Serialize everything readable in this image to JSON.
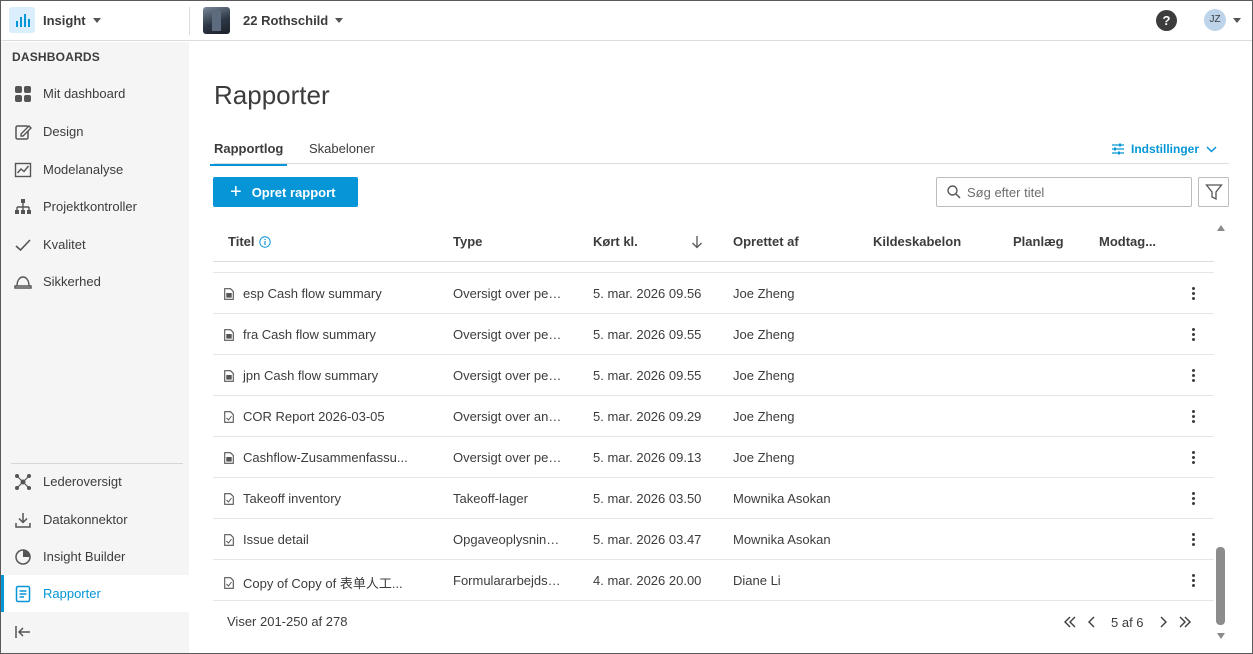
{
  "topbar": {
    "app_name": "Insight",
    "project_name": "22 Rothschild",
    "help_label": "?",
    "user_initials": "JZ"
  },
  "sidebar": {
    "heading": "DASHBOARDS",
    "items": [
      {
        "label": "Mit dashboard",
        "icon": "grid-icon"
      },
      {
        "label": "Design",
        "icon": "edit-icon"
      },
      {
        "label": "Modelanalyse",
        "icon": "chart-icon"
      },
      {
        "label": "Projektkontroller",
        "icon": "hierarchy-icon"
      },
      {
        "label": "Kvalitet",
        "icon": "check-icon"
      },
      {
        "label": "Sikkerhed",
        "icon": "hardhat-icon"
      }
    ],
    "bottom_items": [
      {
        "label": "Lederoversigt",
        "icon": "network-icon"
      },
      {
        "label": "Datakonnektor",
        "icon": "download-icon"
      },
      {
        "label": "Insight Builder",
        "icon": "pie-icon"
      },
      {
        "label": "Rapporter",
        "icon": "report-icon",
        "active": true
      }
    ]
  },
  "main": {
    "title": "Rapporter",
    "tabs": [
      {
        "label": "Rapportlog",
        "active": true
      },
      {
        "label": "Skabeloner",
        "active": false
      }
    ],
    "settings_label": "Indstillinger",
    "create_button": "Opret rapport",
    "search_placeholder": "Søg efter titel",
    "columns": {
      "title": "Titel",
      "type": "Type",
      "run_at": "Kørt kl.",
      "created_by": "Oprettet af",
      "source_template": "Kildeskabelon",
      "schedule": "Planlæg",
      "recipients": "Modtag..."
    },
    "rows": [
      {
        "title": "esp Cash flow summary",
        "type": "Oversigt over pen...",
        "date": "5. mar. 2026 09.56",
        "owner": "Joe Zheng",
        "icon": "doc-filled"
      },
      {
        "title": "fra Cash flow summary",
        "type": "Oversigt over pen...",
        "date": "5. mar. 2026 09.55",
        "owner": "Joe Zheng",
        "icon": "doc-filled"
      },
      {
        "title": "jpn Cash flow summary",
        "type": "Oversigt over pen...",
        "date": "5. mar. 2026 09.55",
        "owner": "Joe Zheng",
        "icon": "doc-filled"
      },
      {
        "title": "COR Report 2026-03-05",
        "type": "Oversigt over anm...",
        "date": "5. mar. 2026 09.29",
        "owner": "Joe Zheng",
        "icon": "doc-outline"
      },
      {
        "title": "Cashflow-Zusammenfassu...",
        "type": "Oversigt over pen...",
        "date": "5. mar. 2026 09.13",
        "owner": "Joe Zheng",
        "icon": "doc-filled"
      },
      {
        "title": "Takeoff inventory",
        "type": "Takeoff-lager",
        "date": "5. mar. 2026 03.50",
        "owner": "Mownika Asokan",
        "icon": "doc-outline"
      },
      {
        "title": "Issue detail",
        "type": "Opgaveoplysninger",
        "date": "5. mar. 2026 03.47",
        "owner": "Mownika Asokan",
        "icon": "doc-outline"
      },
      {
        "title": "Copy of Copy of 表单人工...",
        "type": "Formulararbejdso...",
        "date": "4. mar. 2026 20.00",
        "owner": "Diane Li",
        "icon": "doc-outline"
      }
    ],
    "footer_info": "Viser 201-250 af 278",
    "pager_text": "5 af 6"
  },
  "colors": {
    "accent": "#0696d7",
    "text": "#3c3c3c",
    "sidebar_bg": "#f5f5f5"
  }
}
